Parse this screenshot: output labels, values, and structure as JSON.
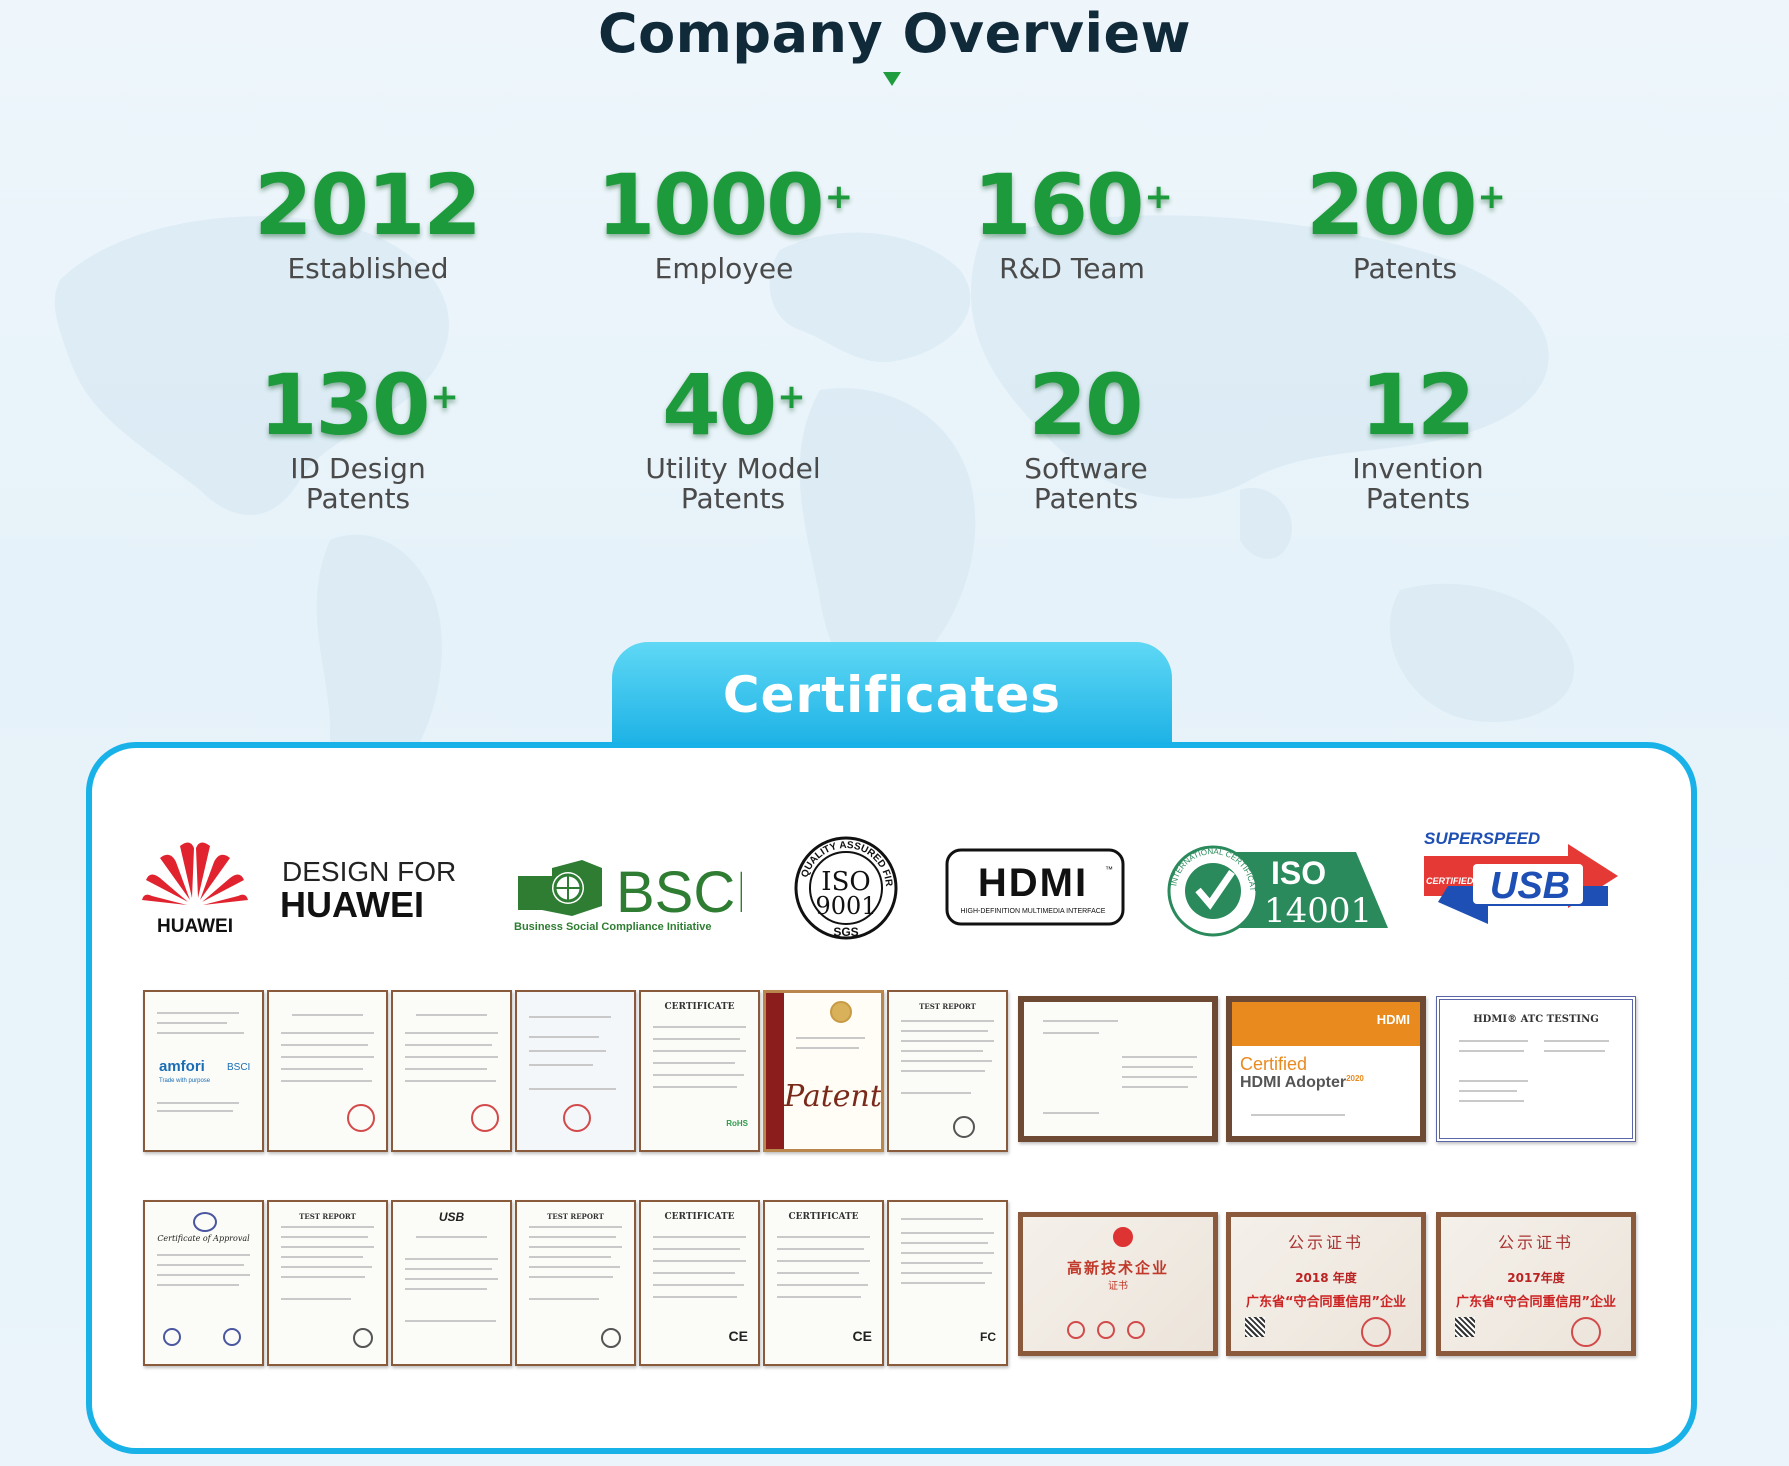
{
  "title": "Company Overview",
  "stats": [
    {
      "num": "2012",
      "plus": "",
      "label1": "Established",
      "label2": ""
    },
    {
      "num": "1000",
      "plus": "+",
      "label1": "Employee",
      "label2": ""
    },
    {
      "num": "160",
      "plus": "+",
      "label1": "R&D Team",
      "label2": ""
    },
    {
      "num": "200",
      "plus": "+",
      "label1": "Patents",
      "label2": ""
    },
    {
      "num": "130",
      "plus": "+",
      "label1": "ID Design",
      "label2": "Patents"
    },
    {
      "num": "40",
      "plus": "+",
      "label1": "Utility Model",
      "label2": "Patents"
    },
    {
      "num": "20",
      "plus": "",
      "label1": "Software",
      "label2": "Patents"
    },
    {
      "num": "12",
      "plus": "",
      "label1": "Invention",
      "label2": "Patents"
    }
  ],
  "certificates": {
    "heading": "Certificates",
    "logos": {
      "huawei": "HUAWEI",
      "design_for_line1": "DESIGN FOR",
      "design_for_line2": "HUAWEI",
      "bsci_main": "BSCI",
      "bsci_sub": "Business Social Compliance Initiative",
      "iso9001_ring": "QUALITY ASSURED FIRM",
      "iso9001_iso": "ISO",
      "iso9001_num": "9001",
      "iso9001_sgs": "SGS",
      "hdmi": "HDMI",
      "hdmi_tm": "™",
      "hdmi_sub": "HIGH-DEFINITION MULTIMEDIA INTERFACE",
      "iso14001_ring": "INTERNATIONAL CERTIFICATION",
      "iso14001_iso": "ISO",
      "iso14001_num": "14001",
      "usb_superspeed": "SUPERSPEED",
      "usb_certified": "CERTIFIED",
      "usb_main": "USB"
    },
    "docs": {
      "amfori": "amfori",
      "bsci_small": "BSCI",
      "amfori_tag": "Trade with purpose",
      "certificate": "CERTIFICATE",
      "rohs": "RoHS",
      "patent": "Patent",
      "test_report": "TEST REPORT",
      "hdmi_small": "HDMI",
      "hdmi_certified": "Certified",
      "hdmi_adopter": "HDMI Adopter",
      "hdmi_year": "2020",
      "hdmi_atc": "HDMI® ATC TESTING",
      "cert_approval": "Certificate of Approval",
      "usb_small": "USB",
      "ce": "CE",
      "fc": "FC",
      "gaoxin": "高新技术企业",
      "gaoxin_sub": "证书",
      "gongshi": "公示证书",
      "year2018": "2018 年度",
      "year2017": "2017年度",
      "shouxin": "广东省“守合同重信用”企业"
    }
  },
  "colors": {
    "green": "#1d9a3b",
    "blue": "#19b2e8",
    "iso14001": "#2a8a5c",
    "usb_red": "#e53935",
    "usb_blue": "#1e4fb4",
    "huawei_red": "#e0232e"
  }
}
